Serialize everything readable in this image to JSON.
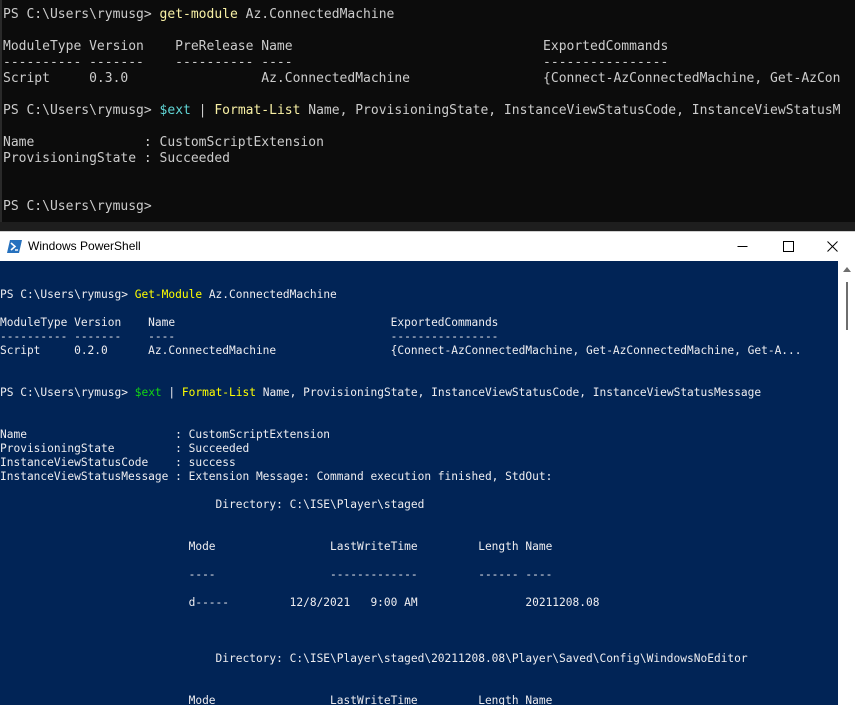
{
  "terminal_top": {
    "lines": [
      {
        "prompt": "PS C:\\Users\\rymusg> ",
        "command": "get-module",
        "args": " Az.ConnectedMachine"
      },
      {
        "text": "ModuleType Version    PreRelease Name                                ExportedCommands"
      },
      {
        "text": "---------- -------    ---------- ----                                ----------------"
      },
      {
        "text": "Script     0.3.0                 Az.ConnectedMachine                 {Connect-AzConnectedMachine, Get-AzCon"
      },
      {
        "prompt": "PS C:\\Users\\rymusg> ",
        "variable": "$ext",
        "pipe": " | ",
        "command": "Format-List",
        "args": " Name, ProvisioningState, InstanceViewStatusCode, InstanceViewStatusM"
      },
      {
        "text": "Name              : CustomScriptExtension"
      },
      {
        "text": "ProvisioningState : Succeeded"
      },
      {
        "text": "PS C:\\Users\\rymusg>"
      }
    ]
  },
  "window": {
    "title": "Windows PowerShell",
    "controls": {
      "minimize": "minimize",
      "maximize": "maximize",
      "close": "close"
    }
  },
  "terminal_main": {
    "lines": [
      {
        "prompt": "PS C:\\Users\\rymusg> ",
        "command": "Get-Module",
        "args": " Az.ConnectedMachine"
      },
      {
        "text": "ModuleType Version    Name                                ExportedCommands"
      },
      {
        "text": "---------- -------    ----                                ----------------"
      },
      {
        "text": "Script     0.2.0      Az.ConnectedMachine                 {Connect-AzConnectedMachine, Get-AzConnectedMachine, Get-A..."
      },
      {
        "prompt": "PS C:\\Users\\rymusg> ",
        "variable": "$ext",
        "pipe": " | ",
        "command": "Format-List",
        "args": " Name, ProvisioningState, InstanceViewStatusCode, InstanceViewStatusMessage"
      },
      {
        "text": "Name                      : CustomScriptExtension"
      },
      {
        "text": "ProvisioningState         : Succeeded"
      },
      {
        "text": "InstanceViewStatusCode    : success"
      },
      {
        "text": "InstanceViewStatusMessage : Extension Message: Command execution finished, StdOut:"
      },
      {
        "text": "                                Directory: C:\\ISE\\Player\\staged"
      },
      {
        "text": "                            Mode                 LastWriteTime         Length Name"
      },
      {
        "text": "                            ----                 -------------         ------ ----"
      },
      {
        "text": "                            d-----         12/8/2021   9:00 AM                20211208.08"
      },
      {
        "text": "                                Directory: C:\\ISE\\Player\\staged\\20211208.08\\Player\\Saved\\Config\\WindowsNoEditor"
      },
      {
        "text": "                            Mode                 LastWriteTime         Length Name"
      }
    ]
  }
}
